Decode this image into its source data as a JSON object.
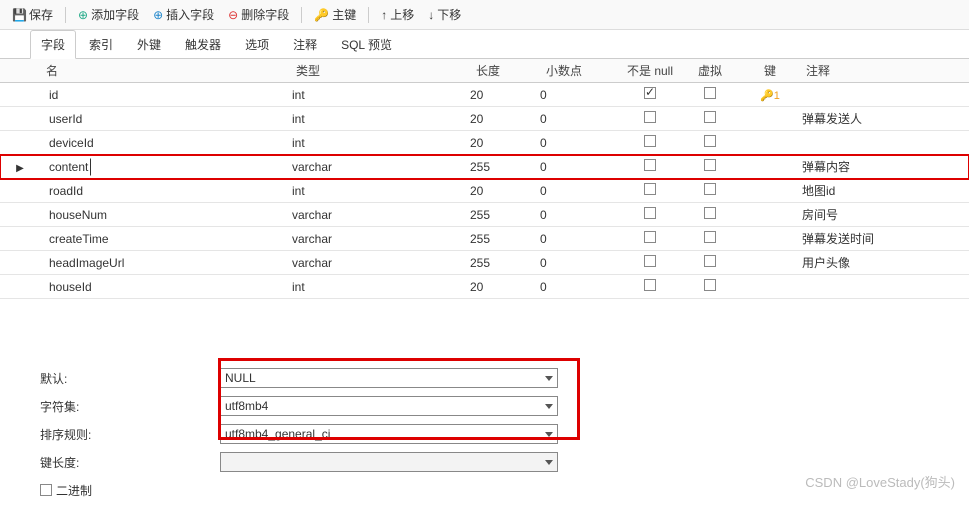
{
  "toolbar": {
    "save": "保存",
    "addField": "添加字段",
    "insertField": "插入字段",
    "deleteField": "删除字段",
    "primaryKey": "主键",
    "moveUp": "上移",
    "moveDown": "下移"
  },
  "tabs": {
    "fields": "字段",
    "indexes": "索引",
    "fk": "外键",
    "triggers": "触发器",
    "options": "选项",
    "comment": "注释",
    "sql": "SQL 预览"
  },
  "headers": {
    "name": "名",
    "type": "类型",
    "length": "长度",
    "decimals": "小数点",
    "notnull": "不是 null",
    "virtual": "虚拟",
    "key": "键",
    "comment": "注释"
  },
  "rows": [
    {
      "name": "id",
      "type": "int",
      "len": "20",
      "dec": "0",
      "notnull": true,
      "virtual": false,
      "key": "1",
      "comment": ""
    },
    {
      "name": "userId",
      "type": "int",
      "len": "20",
      "dec": "0",
      "notnull": false,
      "virtual": false,
      "key": "",
      "comment": "弹幕发送人"
    },
    {
      "name": "deviceId",
      "type": "int",
      "len": "20",
      "dec": "0",
      "notnull": false,
      "virtual": false,
      "key": "",
      "comment": ""
    },
    {
      "name": "content",
      "type": "varchar",
      "len": "255",
      "dec": "0",
      "notnull": false,
      "virtual": false,
      "key": "",
      "comment": "弹幕内容",
      "selected": true
    },
    {
      "name": "roadId",
      "type": "int",
      "len": "20",
      "dec": "0",
      "notnull": false,
      "virtual": false,
      "key": "",
      "comment": "地图id"
    },
    {
      "name": "houseNum",
      "type": "varchar",
      "len": "255",
      "dec": "0",
      "notnull": false,
      "virtual": false,
      "key": "",
      "comment": "房间号"
    },
    {
      "name": "createTime",
      "type": "varchar",
      "len": "255",
      "dec": "0",
      "notnull": false,
      "virtual": false,
      "key": "",
      "comment": "弹幕发送时间"
    },
    {
      "name": "headImageUrl",
      "type": "varchar",
      "len": "255",
      "dec": "0",
      "notnull": false,
      "virtual": false,
      "key": "",
      "comment": "用户头像"
    },
    {
      "name": "houseId",
      "type": "int",
      "len": "20",
      "dec": "0",
      "notnull": false,
      "virtual": false,
      "key": "",
      "comment": ""
    }
  ],
  "props": {
    "defaultLabel": "默认:",
    "defaultValue": "NULL",
    "charsetLabel": "字符集:",
    "charsetValue": "utf8mb4",
    "collationLabel": "排序规则:",
    "collationValue": "utf8mb4_general_ci",
    "keyLenLabel": "键长度:",
    "binaryLabel": "二进制"
  },
  "watermark": "CSDN @LoveStady(狗头)"
}
